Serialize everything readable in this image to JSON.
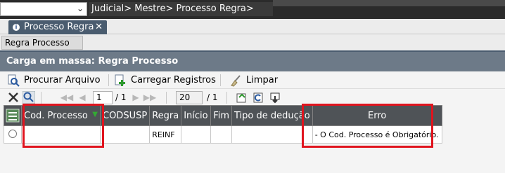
{
  "topbar": {
    "breadcrumb": "Judicial> Mestre> Processo Regra>"
  },
  "tab": {
    "label": "Processo Regra",
    "close": "✕"
  },
  "subtab": {
    "label": "Regra Processo"
  },
  "panel": {
    "title": "Carga em massa: Regra Processo"
  },
  "toolbar": {
    "procurar": "Procurar Arquivo",
    "carregar": "Carregar Registros",
    "limpar": "Limpar"
  },
  "pager": {
    "page": "1",
    "page_total": "/ 1",
    "page_size": "20",
    "size_total": "/ 1"
  },
  "grid": {
    "headers": [
      "Cod. Processo",
      "CODSUSP",
      "Regra",
      "Início",
      "Fim",
      "Tipo de dedução",
      "Erro"
    ],
    "rows": [
      {
        "cod_processo": "",
        "codsusp": "",
        "regra": "REINF",
        "inicio": "",
        "fim": "",
        "tipo_deducao": "",
        "erro": "- O Cod. Processo é Obrigatório."
      }
    ]
  },
  "colors": {
    "highlight": "#e0141e",
    "header": "#4f5357",
    "title_bar": "#6d7a88"
  }
}
